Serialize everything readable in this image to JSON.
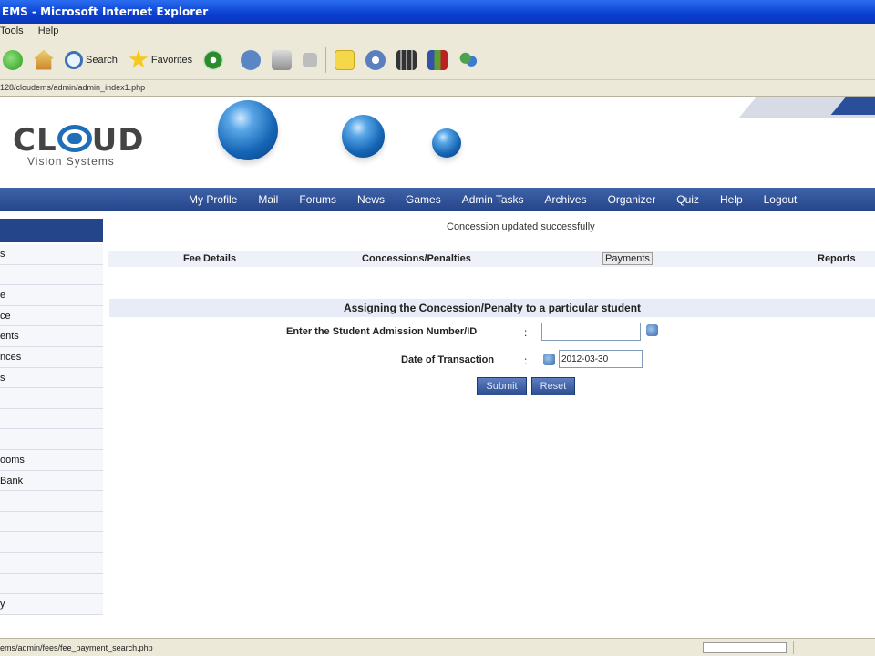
{
  "window": {
    "title": "EMS - Microsoft Internet Explorer"
  },
  "menu": {
    "items": [
      "Tools",
      "Help"
    ]
  },
  "toolbar": {
    "search_label": "Search",
    "favorites_label": "Favorites"
  },
  "address": {
    "url": "128/cloudems/admin/admin_index1.php"
  },
  "brand": {
    "name_prefix": "CL",
    "name_suffix": "UD",
    "tagline": "Vision Systems"
  },
  "nav": {
    "items": [
      "My Profile",
      "Mail",
      "Forums",
      "News",
      "Games",
      "Admin Tasks",
      "Archives",
      "Organizer",
      "Quiz",
      "Help",
      "Logout"
    ]
  },
  "sidebar": {
    "items": [
      "s",
      "",
      "e",
      "ce",
      "ents",
      "nces",
      "s",
      "",
      "",
      "",
      "ooms",
      "Bank",
      "",
      "",
      "",
      "",
      "",
      "y"
    ]
  },
  "content": {
    "message": "Concession updated successfully",
    "tabs": {
      "fee_details": "Fee Details",
      "concessions": "Concessions/Penalties",
      "payments": "Payments",
      "reports": "Reports"
    },
    "section_title": "Assigning the Concession/Penalty to a particular student",
    "form": {
      "admission_label": "Enter the Student Admission Number/ID",
      "admission_value": "",
      "date_label": "Date of Transaction",
      "date_value": "2012-03-30",
      "colon": ":",
      "submit_label": "Submit",
      "reset_label": "Reset"
    }
  },
  "status": {
    "text": "ems/admin/fees/fee_payment_search.php"
  }
}
